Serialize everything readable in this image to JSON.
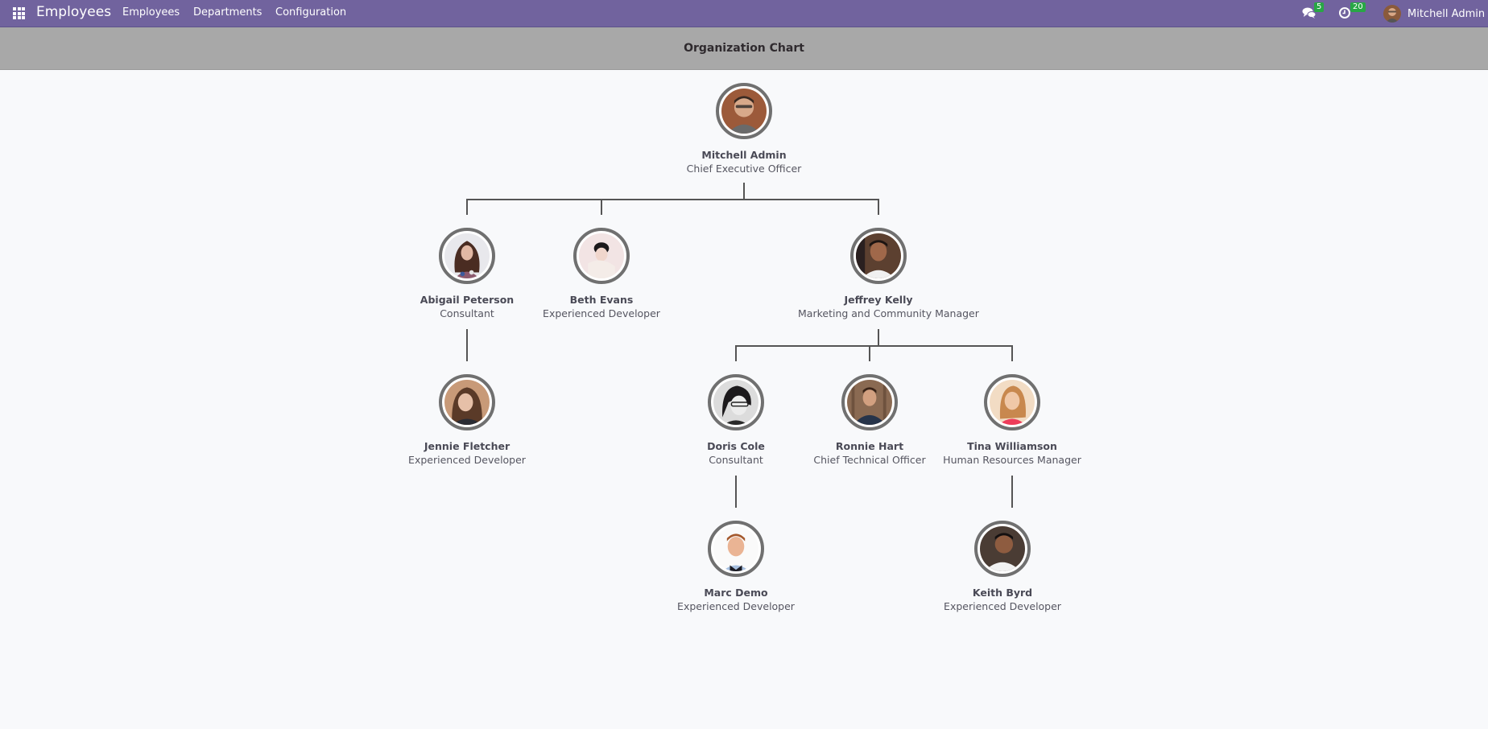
{
  "navbar": {
    "apps_icon": "apps-grid-icon",
    "brand": "Employees",
    "menu": [
      "Employees",
      "Departments",
      "Configuration"
    ],
    "messages_icon": "chat-bubbles-icon",
    "messages_count": "5",
    "activities_icon": "clock-icon",
    "activities_count": "20",
    "user_name": "Mitchell Admin"
  },
  "control_panel": {
    "title": "Organization Chart"
  },
  "colors": {
    "navbar": "#71639e",
    "control_panel": "#a8a8a8",
    "badge": "#28a745",
    "connector": "#555555",
    "background": "#f8f9fb"
  },
  "org_chart": {
    "nodes": [
      {
        "id": "mitchell",
        "name": "Mitchell Admin",
        "job": "Chief Executive Officer",
        "manager": null
      },
      {
        "id": "abigail",
        "name": "Abigail Peterson",
        "job": "Consultant",
        "manager": "mitchell"
      },
      {
        "id": "beth",
        "name": "Beth Evans",
        "job": "Experienced Developer",
        "manager": "mitchell"
      },
      {
        "id": "jeffrey",
        "name": "Jeffrey Kelly",
        "job": "Marketing and Community Manager",
        "manager": "mitchell"
      },
      {
        "id": "jennie",
        "name": "Jennie Fletcher",
        "job": "Experienced Developer",
        "manager": "abigail"
      },
      {
        "id": "doris",
        "name": "Doris Cole",
        "job": "Consultant",
        "manager": "jeffrey"
      },
      {
        "id": "ronnie",
        "name": "Ronnie Hart",
        "job": "Chief Technical Officer",
        "manager": "jeffrey"
      },
      {
        "id": "tina",
        "name": "Tina Williamson",
        "job": "Human Resources Manager",
        "manager": "jeffrey"
      },
      {
        "id": "marc",
        "name": "Marc Demo",
        "job": "Experienced Developer",
        "manager": "doris"
      },
      {
        "id": "keith",
        "name": "Keith Byrd",
        "job": "Experienced Developer",
        "manager": "tina"
      }
    ]
  }
}
